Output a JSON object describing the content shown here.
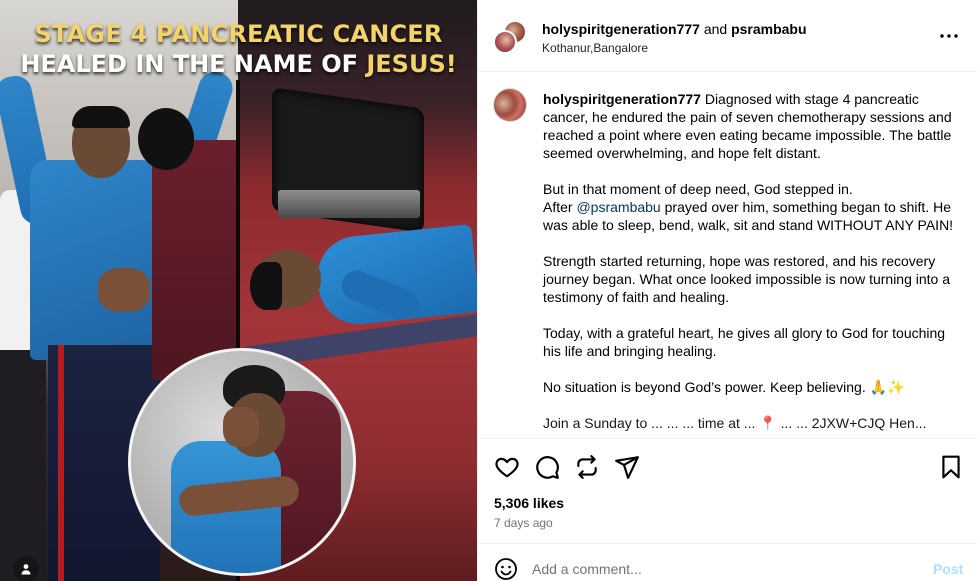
{
  "media": {
    "headline_line1": "STAGE 4 PANCREATIC CANCER",
    "headline_line2_part1": "HEALED IN THE NAME OF ",
    "headline_line2_part2": "JESUS!",
    "colors": {
      "gold": "#f3d36b",
      "blue_shirt": "#2f86c9",
      "stage_red": "#a3353a"
    },
    "tag_icon": "user-icon"
  },
  "header": {
    "user1": "holyspiritgeneration777",
    "and": " and ",
    "user2": "psrambabu",
    "location": "Kothanur,Bangalore",
    "more_icon": "more-horizontal-icon"
  },
  "caption": {
    "username": "holyspiritgeneration777",
    "p1": " Diagnosed with stage 4 pancreatic cancer, he endured the pain of seven chemotherapy sessions and reached a point where even eating became impossible. The battle seemed overwhelming, and hope felt distant.",
    "p2a": "But in that moment of deep need, God stepped in.",
    "p2b_pre": "After ",
    "p2b_mention": "@psrambabu",
    "p2b_post": " prayed over him, something began to shift. He was able to sleep, bend, walk, sit and stand WITHOUT ANY PAIN!",
    "p3": "Strength started returning, hope was restored, and his recovery journey began. What once looked impossible is now turning into a testimony of faith and healing.",
    "p4": "Today, with a grateful heart, he gives all glory to God for touching his life and bringing healing.",
    "p5": "No situation is beyond God’s power. Keep believing. 🙏✨",
    "p6": "Join a Sunday to ... ... ... time at ... 📍 ... ... 2JXW+CJQ Hen..."
  },
  "actions": {
    "like_icon": "heart-icon",
    "comment_icon": "comment-icon",
    "share_icon": "repost-icon",
    "send_icon": "send-icon",
    "save_icon": "bookmark-icon",
    "likes": "5,306 likes",
    "time_ago": "7 days ago"
  },
  "comment": {
    "emoji_icon": "emoji-icon",
    "placeholder": "Add a comment...",
    "post_label": "Post",
    "post_color": "#b2dffc"
  }
}
